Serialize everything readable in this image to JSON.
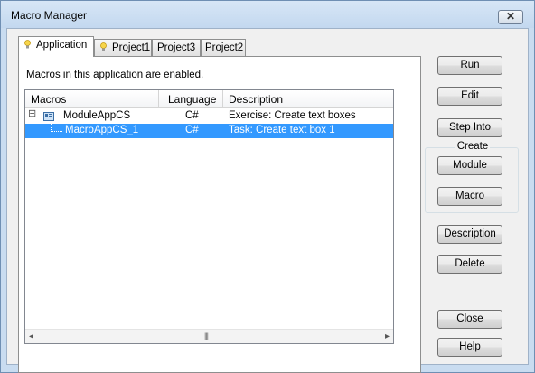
{
  "window": {
    "title": "Macro Manager",
    "close_glyph": "✕"
  },
  "tabs": [
    {
      "label": "Application",
      "icon": "lightbulb-icon",
      "active": true
    },
    {
      "label": "Project1",
      "icon": "lightbulb-icon",
      "active": false
    },
    {
      "label": "Project3",
      "active": false
    },
    {
      "label": "Project2",
      "active": false
    }
  ],
  "panel": {
    "status_message": "Macros in this application are enabled."
  },
  "list": {
    "columns": [
      "Macros",
      "Language",
      "Description"
    ],
    "rows": [
      {
        "name": "ModuleAppCS",
        "language": "C#",
        "description": "Exercise: Create text boxes",
        "expander": "⊟",
        "icon": "module-icon"
      },
      {
        "name": "MacroAppCS_1",
        "language": "C#",
        "description": "Task: Create text box 1",
        "selected": true
      }
    ],
    "scroll_left": "◂",
    "scroll_right": "▸",
    "scroll_grip": "|||"
  },
  "buttons": {
    "run": "Run",
    "edit": "Edit",
    "step_into": "Step Into",
    "create_group_label": "Create",
    "module": "Module",
    "macro": "Macro",
    "description": "Description",
    "delete": "Delete",
    "close": "Close",
    "help": "Help"
  },
  "colors": {
    "selection": "#3399ff",
    "client_bg": "#f0f0f0",
    "frame": "#c9dcf0"
  }
}
